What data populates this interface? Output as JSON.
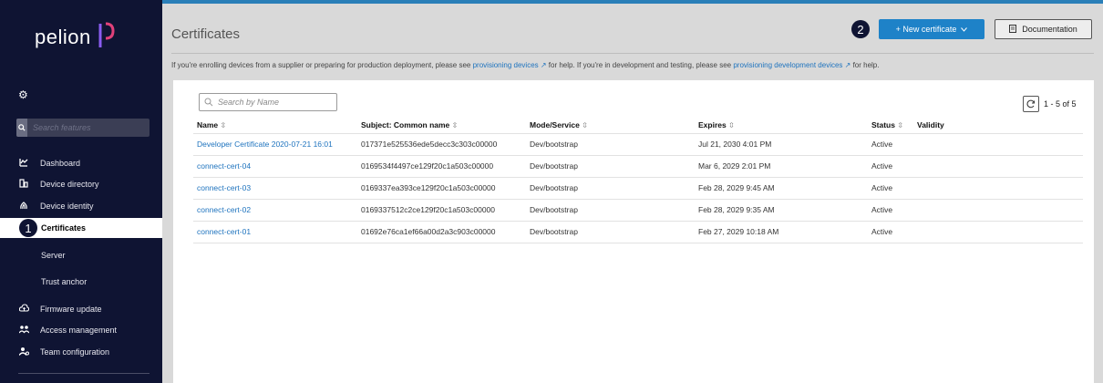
{
  "sidebar": {
    "logo_text": "pelion",
    "search_placeholder": "Search features",
    "items": [
      {
        "label": "Dashboard",
        "icon": "chart-icon"
      },
      {
        "label": "Device directory",
        "icon": "devices-icon"
      },
      {
        "label": "Device identity",
        "icon": "fingerprint-icon"
      },
      {
        "label": "Certificates",
        "icon": "",
        "active": true
      },
      {
        "label": "Server",
        "icon": ""
      },
      {
        "label": "Trust anchor",
        "icon": ""
      },
      {
        "label": "Firmware update",
        "icon": "cloud-upload-icon"
      },
      {
        "label": "Access management",
        "icon": "users-icon"
      },
      {
        "label": "Team configuration",
        "icon": "team-icon"
      }
    ]
  },
  "markers": {
    "one": "1",
    "two": "2"
  },
  "header": {
    "title": "Certificates",
    "new_button": "+ New certificate",
    "doc_button": "Documentation",
    "info_prefix": "If you're enrolling devices from a supplier or preparing for production deployment, please see ",
    "info_link1": "provisioning devices ↗",
    "info_mid": " for help. If you're in development and testing, please see ",
    "info_link2": "provisioning development devices ↗",
    "info_suffix": " for help."
  },
  "table": {
    "search_placeholder": "Search by Name",
    "count": "1 - 5 of 5",
    "columns": [
      "Name",
      "Subject: Common name",
      "Mode/Service",
      "Expires",
      "Status",
      "Validity"
    ],
    "rows": [
      {
        "name": "Developer Certificate 2020-07-21 16:01",
        "cn": "017371e525536ede5decc3c303c00000",
        "mode": "Dev/bootstrap",
        "expires": "Jul 21, 2030 4:01 PM",
        "status": "Active",
        "validity": ""
      },
      {
        "name": "connect-cert-04",
        "cn": "0169534f4497ce129f20c1a503c00000",
        "mode": "Dev/bootstrap",
        "expires": "Mar 6, 2029 2:01 PM",
        "status": "Active",
        "validity": ""
      },
      {
        "name": "connect-cert-03",
        "cn": "0169337ea393ce129f20c1a503c00000",
        "mode": "Dev/bootstrap",
        "expires": "Feb 28, 2029 9:45 AM",
        "status": "Active",
        "validity": ""
      },
      {
        "name": "connect-cert-02",
        "cn": "0169337512c2ce129f20c1a503c00000",
        "mode": "Dev/bootstrap",
        "expires": "Feb 28, 2029 9:35 AM",
        "status": "Active",
        "validity": ""
      },
      {
        "name": "connect-cert-01",
        "cn": "01692e76ca1ef66a00d2a3c903c00000",
        "mode": "Dev/bootstrap",
        "expires": "Feb 27, 2029 10:18 AM",
        "status": "Active",
        "validity": ""
      }
    ]
  },
  "colors": {
    "sidebar_bg": "#0f1433",
    "accent": "#1e82c8",
    "link": "#1e73be"
  }
}
